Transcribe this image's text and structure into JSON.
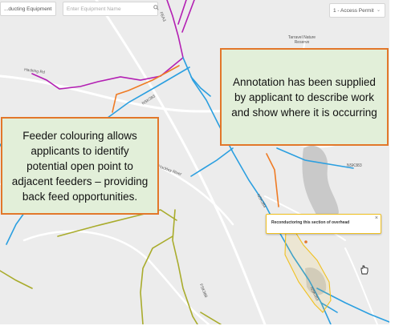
{
  "toolbar": {
    "equipment_select": "...ducting Equipment",
    "equipment_search_placeholder": "Enter Equipment Name",
    "permit_select": "1 - Access Permit"
  },
  "map": {
    "reserve_label": "Tarravel Nature Reserve",
    "road_labels": [
      "Hacking Rd",
      "NSK383",
      "Hackley River",
      "NSK383",
      "NSK384",
      "FEA3",
      "FSK388",
      "NSK383"
    ]
  },
  "popup": {
    "text": "Reconductoring this section of overhead",
    "close": "×"
  },
  "callouts": {
    "feeder": "Feeder colouring allows applicants to identify potential open point to adjacent feeders – providing back feed opportunities.",
    "annotation": "Annotation has been supplied by applicant to describe work and show where it is occurring"
  },
  "colors": {
    "callout_bg": "#e2efd9",
    "callout_border": "#e2772a",
    "feeder_magenta": "#b31fb3",
    "feeder_blue": "#2b9fe0",
    "feeder_orange": "#ef7b24",
    "feeder_olive": "#a9ac2c"
  },
  "icons": [
    "search-icon",
    "chevron-down-icon",
    "hand-cursor-icon",
    "close-icon"
  ]
}
